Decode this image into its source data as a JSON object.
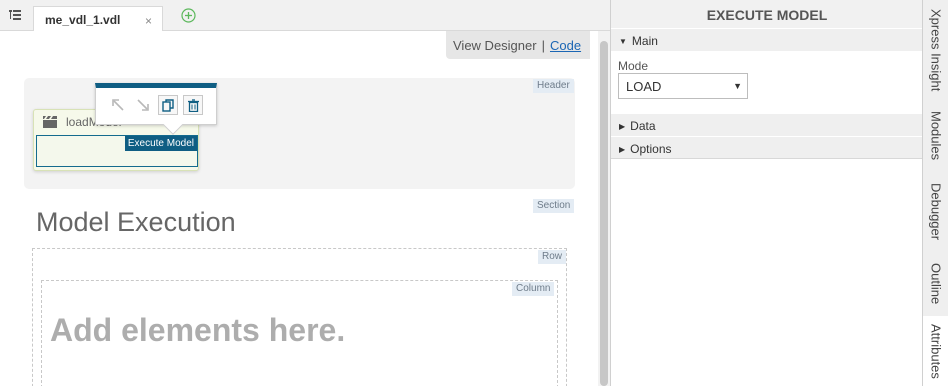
{
  "editor": {
    "tab": {
      "label": "me_vdl_1.vdl",
      "close": "×"
    },
    "view_designer": "View Designer",
    "separator": "|",
    "code_link": "Code"
  },
  "designer": {
    "header_tag": "Header",
    "section_tag": "Section",
    "row_tag": "Row",
    "column_tag": "Column",
    "widget_name": "loadModel",
    "widget_badge": "Execute Model",
    "section_title": "Model Execution",
    "placeholder": "Add elements here."
  },
  "panel": {
    "title": "EXECUTE MODEL",
    "groups": [
      {
        "label": "Main",
        "expanded": true
      },
      {
        "label": "Data",
        "expanded": false
      },
      {
        "label": "Options",
        "expanded": false
      }
    ],
    "mode_label": "Mode",
    "mode_value": "LOAD"
  },
  "side_tabs": [
    "Xpress Insight",
    "Modules",
    "Debugger",
    "Outline",
    "Attributes"
  ],
  "icons": {
    "tree": "tree-menu-icon",
    "add": "add-circle-icon",
    "clapper": "clapperboard-icon",
    "move_up": "arrow-up-left-icon",
    "move_down": "arrow-down-right-icon",
    "copy": "copy-icon",
    "delete": "trash-icon"
  },
  "colors": {
    "accent": "#0f5e83",
    "link": "#1b66b4",
    "add": "#5cb85c"
  }
}
